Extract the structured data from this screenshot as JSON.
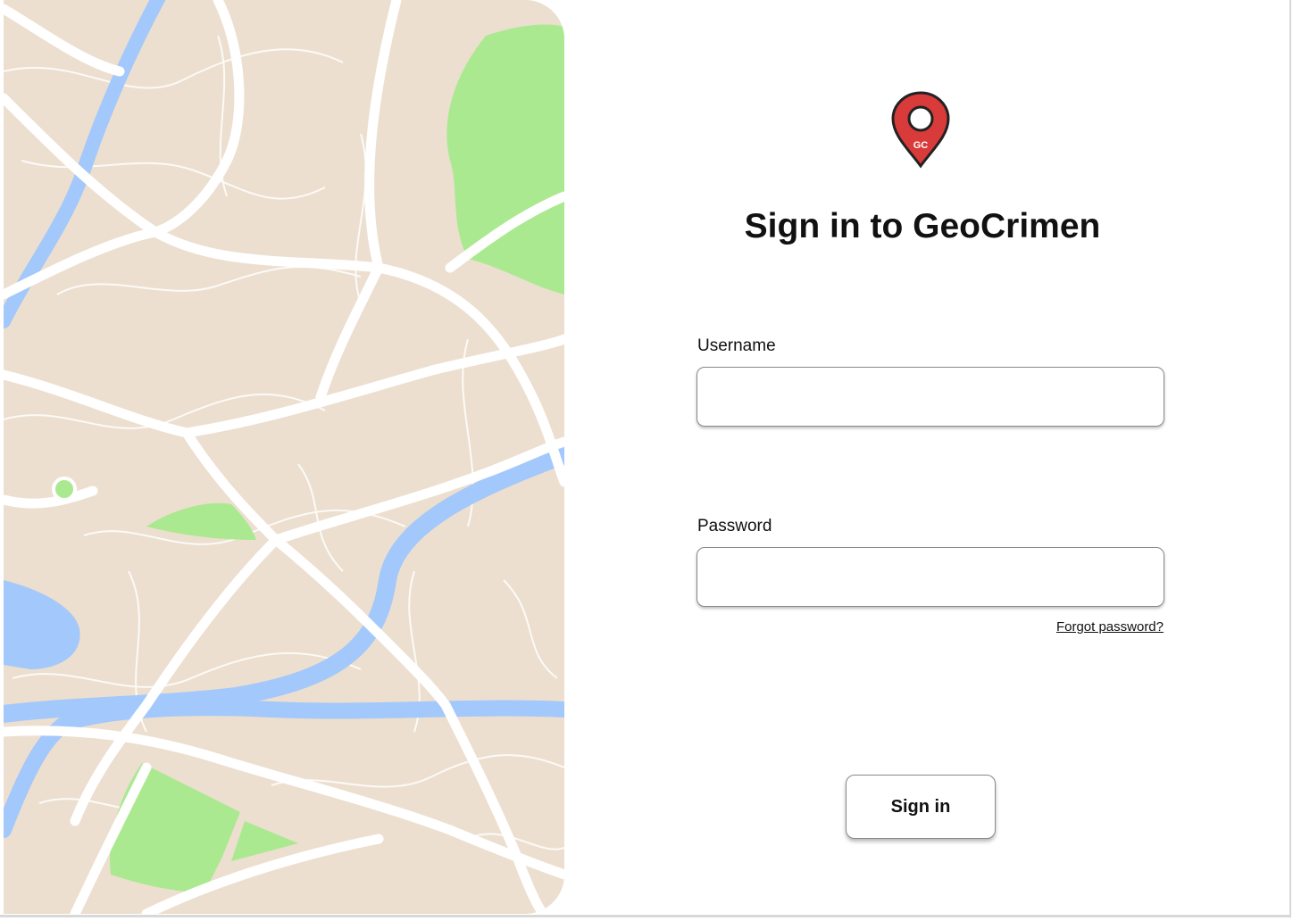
{
  "app": {
    "title": "Sign in to GeoCrimen",
    "logo_text": "GC",
    "logo_icon": "map-pin-icon"
  },
  "colors": {
    "map_land": "#ecdfcf",
    "map_water": "#a3c8fb",
    "map_park": "#abe991",
    "map_road": "#ffffff",
    "pin_red": "#d93a3a"
  },
  "form": {
    "username_label": "Username",
    "username_value": "",
    "password_label": "Password",
    "password_value": "",
    "forgot_password": "Forgot password?",
    "submit_label": "Sign in"
  }
}
